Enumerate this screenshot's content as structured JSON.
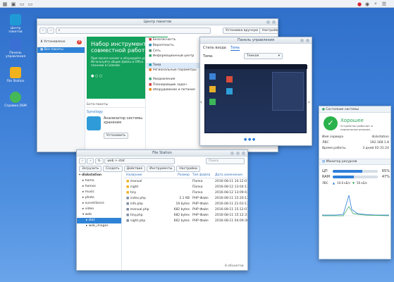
{
  "desktop": {
    "icons": [
      {
        "label": "Центр пакетов"
      },
      {
        "label": "Панель управления"
      },
      {
        "label": "File Station"
      },
      {
        "label": "Справка DSM"
      }
    ]
  },
  "package_center": {
    "title": "Центр пакетов",
    "install_manual": "Установка вручную",
    "settings": "Настройки",
    "nav": [
      {
        "label": "Установлено",
        "badge": "4"
      },
      {
        "label": "Все пакеты"
      }
    ],
    "banner_title": "Набор инструмент совместной работ",
    "banner_text": "Пригласите коллег и обсуждайте работу в Chat. Используйте общие файлы в Office. Управляйте планами в Calendar.",
    "beta_label": "Бета-пакеты",
    "brand": "Synology",
    "app_name": "Анализатор системы хранения",
    "install": "Установить",
    "menu": [
      {
        "label": "Безопасность"
      },
      {
        "label": "Вероятность"
      },
      {
        "label": "Сеть"
      },
      {
        "label": "Информационный центр"
      },
      {
        "label": "Тема"
      },
      {
        "label": "Региональные параметры"
      },
      {
        "label": "Уведомления"
      },
      {
        "label": "Планировщик задач"
      },
      {
        "label": "Оборудование и питание"
      }
    ]
  },
  "control_panel": {
    "title": "Панель управления",
    "tabs": [
      "Стиль входа",
      "Тема"
    ],
    "theme_label": "Тема:",
    "theme_value": "Темная"
  },
  "resource_monitor": {
    "title": "Состояние системы",
    "status": "Хорошее",
    "status_sub": "Устройство работает в нормальном режиме.",
    "rows": [
      {
        "key": "Имя сервера",
        "value": "diskstation"
      },
      {
        "key": "ЛВС",
        "value": "192.168.1.8"
      },
      {
        "key": "Время работы",
        "value": "3 дней 02:31:24"
      }
    ],
    "monitor_title": "Монитор ресурсов",
    "cpu_label": "ЦП",
    "cpu": 65,
    "ram_label": "RAM",
    "ram": 47,
    "net_label": "ЛВС",
    "up": "10.6 кБ/с",
    "down": "56 кБ/с"
  },
  "file_station": {
    "title": "File Station",
    "path": "web > stat",
    "toolbar": [
      "Загрузить",
      "Создать",
      "Действие",
      "Инструменты",
      "Настройки"
    ],
    "search_placeholder": "Поиск",
    "tree_root": "diskstation",
    "tree": [
      "home",
      "homes",
      "music",
      "photo",
      "surveillance",
      "video",
      "web",
      "stat",
      "web_images"
    ],
    "columns": [
      "Название",
      "Размер",
      "Тип файла",
      "Дата изменения"
    ],
    "files": [
      {
        "name": "manual",
        "size": "",
        "type": "Папка",
        "date": "2016-08-11 10:12:01"
      },
      {
        "name": "night",
        "size": "",
        "type": "Папка",
        "date": "2016-08-12 13:04:13"
      },
      {
        "name": "tiny",
        "size": "",
        "type": "Папка",
        "date": "2016-08-12 13:09:43"
      },
      {
        "name": "index.php",
        "size": "2.1 KB",
        "type": "PHP Файл",
        "date": "2016-08-11 15:20:13"
      },
      {
        "name": "info.php",
        "size": "19 bytes",
        "type": "PHP Файл",
        "date": "2016-08-11 21:03:13"
      },
      {
        "name": "manual.php",
        "size": "682 bytes",
        "type": "PHP Файл",
        "date": "2016-08-11 15:12:01"
      },
      {
        "name": "tiny.php",
        "size": "682 bytes",
        "type": "PHP Файл",
        "date": "2016-08-11 15:12:31"
      },
      {
        "name": "night.php",
        "size": "662 bytes",
        "type": "PHP Файл",
        "date": "2016-08-11 04:09:30"
      }
    ],
    "footer": "8 объектов"
  }
}
